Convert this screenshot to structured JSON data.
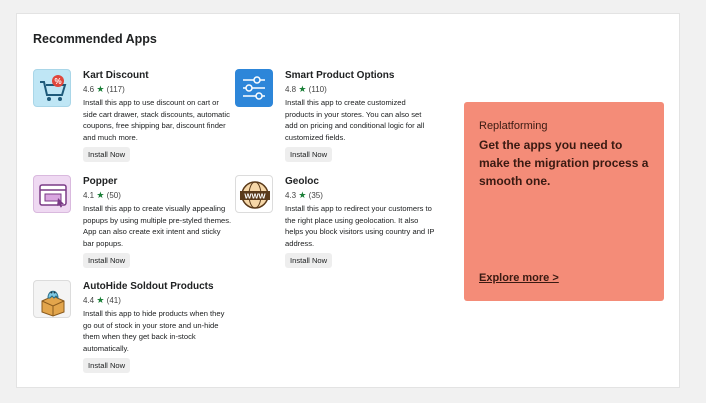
{
  "section": {
    "title": "Recommended Apps"
  },
  "apps": [
    {
      "name": "Kart Discount",
      "rating": "4.6",
      "reviews": "(117)",
      "description": "Install this app to use discount on cart or side cart drawer, stack discounts, automatic coupons, free shipping bar, discount finder and much more.",
      "button": "Install Now",
      "icon": "discount-cart-icon"
    },
    {
      "name": "Smart Product Options",
      "rating": "4.8",
      "reviews": "(110)",
      "description": "Install this app to create customized products in your stores. You can also set add on pricing and conditional logic for all customized fields.",
      "button": "Install Now",
      "icon": "sliders-icon"
    },
    {
      "name": "Popper",
      "rating": "4.1",
      "reviews": "(50)",
      "description": "Install this app to create visually appealing popups by using multiple pre-styled themes. App can also create exit intent and sticky bar popups.",
      "button": "Install Now",
      "icon": "popup-window-icon"
    },
    {
      "name": "Geoloc",
      "rating": "4.3",
      "reviews": "(35)",
      "description": "Install this app to redirect your customers to the right place using geolocation. It also helps you block visitors using country and IP address.",
      "button": "Install Now",
      "icon": "www-globe-icon"
    },
    {
      "name": "AutoHide Soldout Products",
      "rating": "4.4",
      "reviews": "(41)",
      "description": "Install this app to hide products when they go out of stock in your store and un-hide them when they get back in-stock automatically.",
      "button": "Install Now",
      "icon": "box-ghost-icon"
    }
  ],
  "promo": {
    "kicker": "Replatforming",
    "title": "Get the apps you need to make the migration process a smooth one.",
    "link": "Explore more >",
    "background": "#f48c78"
  },
  "colors": {
    "star": "#1a7f37",
    "button_bg": "#eeeeee"
  }
}
